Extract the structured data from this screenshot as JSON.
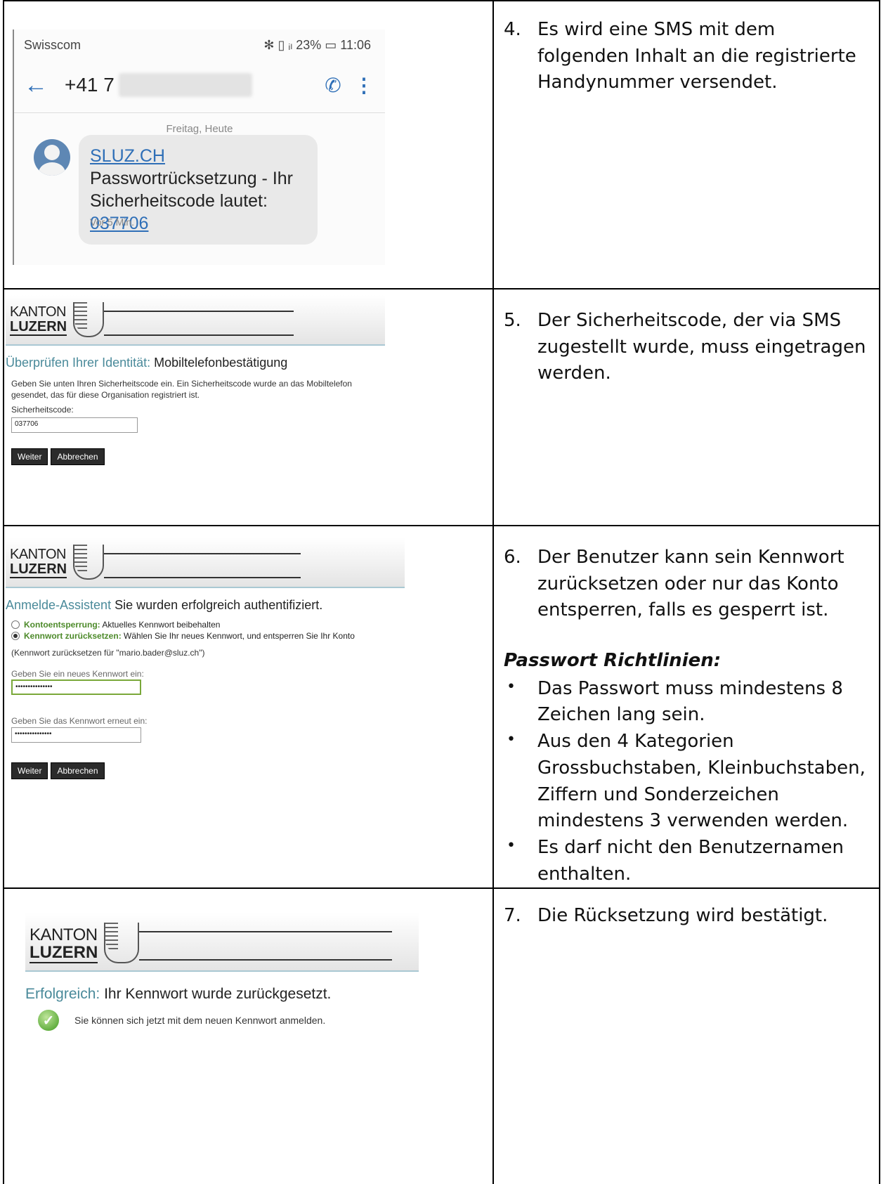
{
  "steps": [
    {
      "num": "4.",
      "text": "Es wird eine SMS mit dem folgenden Inhalt an die registrierte Handynum­mer versendet."
    },
    {
      "num": "5.",
      "text": "Der Sicherheitscode, der via SMS zu­gestellt wurde, muss eingetragen werden."
    },
    {
      "num": "6.",
      "text": "Der Benutzer kann sein Kennwort zurücksetzen oder nur das Konto entsperren, falls es gesperrt ist."
    },
    {
      "num": "7.",
      "text": "Die Rücksetzung wird bestätigt."
    }
  ],
  "password_guidelines": {
    "title": "Passwort Richtlinien:",
    "rules": [
      "Das Passwort muss mindestens 8 Zeichen lang sein.",
      "Aus den 4 Kategorien Grossbuchsta­ben, Kleinbuchstaben, Ziffern und Sonderzeichen mindestens 3 ver­wenden werden.",
      "Es darf nicht den Benutzernamen enthalten."
    ]
  },
  "sms": {
    "carrier": "Swisscom",
    "status_icons": "✻ ▯ ᵢₗ 23% ▭",
    "time": "11:06",
    "contact": "+41 7",
    "date": "Freitag, Heute",
    "link": "SLUZ.CH",
    "message_rest": " Passwortrücksetzung - Ihr Sicherheitscode lautet: ",
    "code": "037706",
    "received": "Vor 5 Min."
  },
  "logo": {
    "line1": "KANTON",
    "line2": "LUZERN"
  },
  "verify": {
    "heading_teal": "Überprüfen Ihrer Identität:",
    "heading_rest": "Mobiltelefonbestätigung",
    "info": "Geben Sie unten Ihren Sicherheitscode ein. Ein Sicherheitscode wurde an das Mobiltelefon gesendet, das für diese Organisation registriert ist.",
    "label": "Sicherheitscode:",
    "value": "037706",
    "next": "Weiter",
    "cancel": "Abbrechen"
  },
  "reset": {
    "heading_teal": "Anmelde-Assistent",
    "heading_rest": "Sie wurden erfolgreich authentifiziert.",
    "opt1_bold": "Kontoentsperrung:",
    "opt1_rest": " Aktuelles Kennwort beibehalten",
    "opt2_bold": "Kennwort zurücksetzen:",
    "opt2_rest": " Wählen Sie Ihr neues Kennwort, und entsperren Sie Ihr Konto",
    "for_user": "(Kennwort zurücksetzen für \"mario.bader@sluz.ch\")",
    "new_label": "Geben Sie ein neues Kennwort ein:",
    "new_value": "•••••••••••••••",
    "confirm_label": "Geben Sie das Kennwort erneut ein:",
    "confirm_value": "•••••••••••••••",
    "next": "Weiter",
    "cancel": "Abbrechen"
  },
  "success": {
    "heading_teal": "Erfolgreich:",
    "heading_rest": "Ihr Kennwort wurde zurückgesetzt.",
    "message": "Sie können sich jetzt mit dem neuen Kennwort anmelden."
  }
}
